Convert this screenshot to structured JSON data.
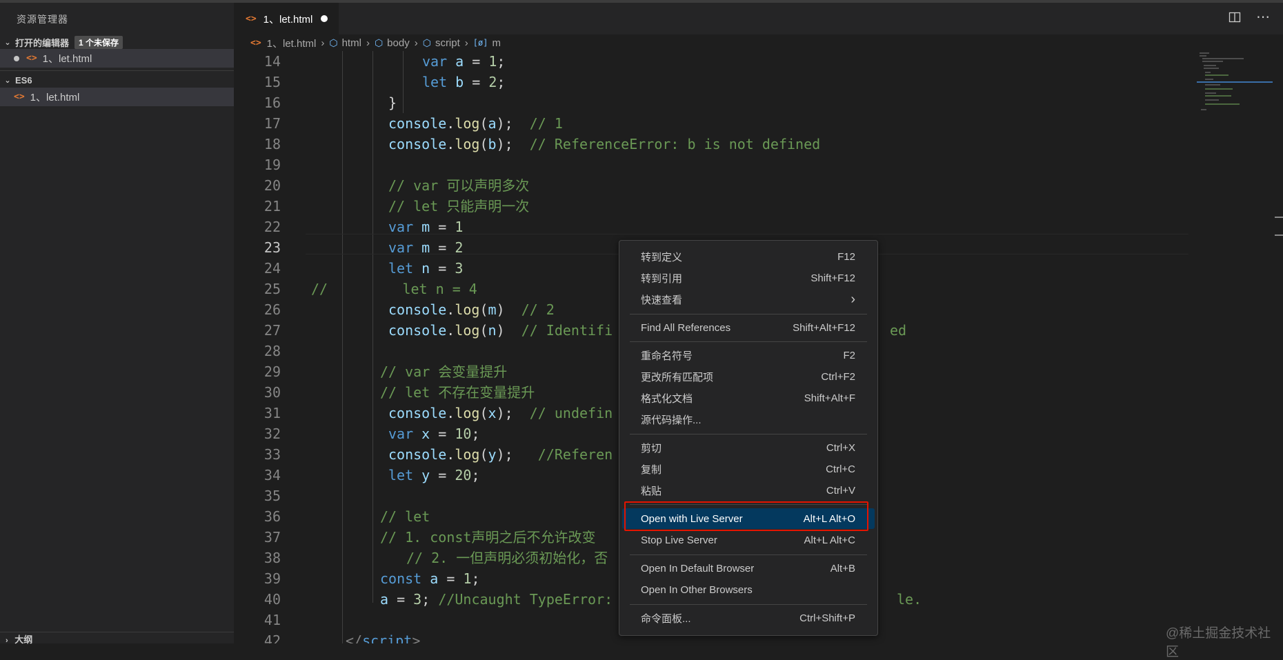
{
  "sidebar": {
    "title": "资源管理器",
    "open_editors": {
      "label": "打开的编辑器",
      "badge": "1 个未保存",
      "file": "1、let.html"
    },
    "folder": {
      "label": "ES6",
      "file": "1、let.html"
    },
    "outline_label": "大纲"
  },
  "tab": {
    "label": "1、let.html"
  },
  "breadcrumb": [
    "1、let.html",
    "html",
    "body",
    "script",
    "m"
  ],
  "editor": {
    "lines": [
      {
        "n": "14"
      },
      {
        "n": "15"
      },
      {
        "n": "16"
      },
      {
        "n": "17"
      },
      {
        "n": "18"
      },
      {
        "n": "19"
      },
      {
        "n": "20"
      },
      {
        "n": "21"
      },
      {
        "n": "22"
      },
      {
        "n": "23"
      },
      {
        "n": "24"
      },
      {
        "n": "25"
      },
      {
        "n": "26"
      },
      {
        "n": "27"
      },
      {
        "n": "28"
      },
      {
        "n": "29"
      },
      {
        "n": "30"
      },
      {
        "n": "31"
      },
      {
        "n": "32"
      },
      {
        "n": "33"
      },
      {
        "n": "34"
      },
      {
        "n": "35"
      },
      {
        "n": "36"
      },
      {
        "n": "37"
      },
      {
        "n": "38"
      },
      {
        "n": "39"
      },
      {
        "n": "40"
      },
      {
        "n": "41"
      },
      {
        "n": "42"
      }
    ],
    "code": {
      "l14": [
        "var",
        "a",
        " = ",
        "1",
        ";"
      ],
      "l15": [
        "let",
        "b",
        " = ",
        "2",
        ";"
      ],
      "l16": "}",
      "l17": [
        "console",
        ".",
        "log",
        "(",
        "a",
        ");  ",
        "// 1"
      ],
      "l18": [
        "console",
        ".",
        "log",
        "(",
        "b",
        ");  ",
        "// ReferenceError: b is not defined"
      ],
      "l20": "// var 可以声明多次",
      "l21": "// let 只能声明一次",
      "l22": [
        "var",
        "m",
        " = ",
        "1"
      ],
      "l23": [
        "var",
        "m",
        " = ",
        "2"
      ],
      "l24": [
        "let",
        "n",
        " = ",
        "3"
      ],
      "l25": "//         let n = 4",
      "l26": [
        "console",
        ".",
        "log",
        "(",
        "m",
        ")  ",
        "// 2"
      ],
      "l27a": [
        "console",
        ".",
        "log",
        "(",
        "n",
        ")  ",
        "// Identifi"
      ],
      "l27b": "ed",
      "l29": "// var 会变量提升",
      "l30": "// let 不存在变量提升",
      "l31": [
        "console",
        ".",
        "log",
        "(",
        "x",
        ");  ",
        "// undefin"
      ],
      "l32": [
        "var",
        "x",
        " = ",
        "10",
        ";"
      ],
      "l33": [
        "console",
        ".",
        "log",
        "(",
        "y",
        ");   ",
        "//Referen"
      ],
      "l34": [
        "let",
        "y",
        " = ",
        "20",
        ";"
      ],
      "l36": "// let",
      "l37": "// 1. const声明之后不允许改变",
      "l38": "// 2. 一但声明必须初始化，否",
      "l39": [
        "const",
        "a",
        " = ",
        "1",
        ";"
      ],
      "l40a": [
        "a",
        " = ",
        "3",
        "; ",
        "//Uncaught TypeError:"
      ],
      "l40b": "le.",
      "l42": [
        "</",
        "script",
        ">"
      ]
    }
  },
  "context_menu": {
    "items": [
      {
        "label": "转到定义",
        "key": "F12"
      },
      {
        "label": "转到引用",
        "key": "Shift+F12"
      },
      {
        "label": "快速查看",
        "key": "›"
      },
      {
        "label": "Find All References",
        "key": "Shift+Alt+F12"
      },
      {
        "label": "重命名符号",
        "key": "F2"
      },
      {
        "label": "更改所有匹配项",
        "key": "Ctrl+F2"
      },
      {
        "label": "格式化文档",
        "key": "Shift+Alt+F"
      },
      {
        "label": "源代码操作...",
        "key": ""
      },
      {
        "label": "剪切",
        "key": "Ctrl+X"
      },
      {
        "label": "复制",
        "key": "Ctrl+C"
      },
      {
        "label": "粘贴",
        "key": "Ctrl+V"
      },
      {
        "label": "Open with Live Server",
        "key": "Alt+L Alt+O"
      },
      {
        "label": "Stop Live Server",
        "key": "Alt+L Alt+C"
      },
      {
        "label": "Open In Default Browser",
        "key": "Alt+B"
      },
      {
        "label": "Open In Other Browsers",
        "key": ""
      },
      {
        "label": "命令面板...",
        "key": "Ctrl+Shift+P"
      }
    ]
  },
  "watermark": "@稀土掘金技术社区",
  "colors": {
    "highlight": "#04395e",
    "annotation_box": "#e51400",
    "accent_icon": "#e37933"
  }
}
